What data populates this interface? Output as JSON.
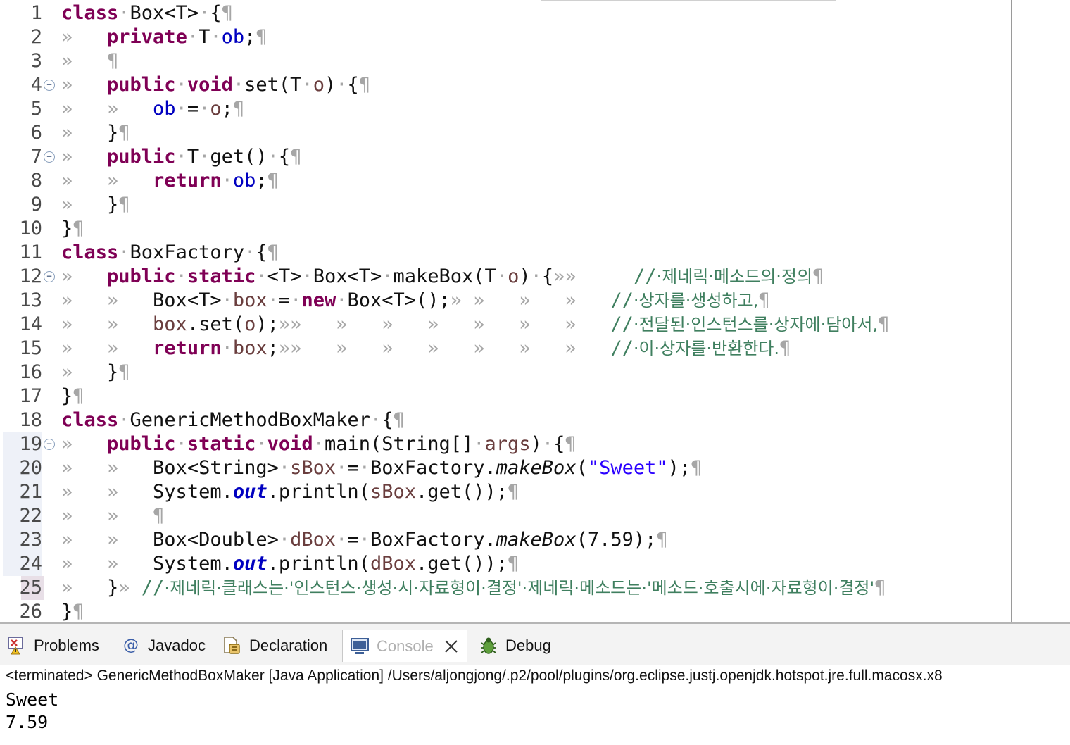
{
  "editor": {
    "line_numbers": [
      "1",
      "2",
      "3",
      "4",
      "5",
      "6",
      "7",
      "8",
      "9",
      "10",
      "11",
      "12",
      "13",
      "14",
      "15",
      "16",
      "17",
      "18",
      "19",
      "20",
      "21",
      "22",
      "23",
      "24",
      "25",
      "26"
    ],
    "lines": [
      [
        [
          "kw",
          "class"
        ],
        [
          "ws",
          "·"
        ],
        [
          "t",
          "Box<T>"
        ],
        [
          "ws",
          "·"
        ],
        [
          "t",
          "{"
        ],
        [
          "ws",
          "¶"
        ]
      ],
      [
        [
          "ws",
          "»   "
        ],
        [
          "kw",
          "private"
        ],
        [
          "ws",
          "·"
        ],
        [
          "t",
          "T"
        ],
        [
          "ws",
          "·"
        ],
        [
          "fld",
          "ob"
        ],
        [
          "t",
          ";"
        ],
        [
          "ws",
          "¶"
        ]
      ],
      [
        [
          "ws",
          "»   "
        ],
        [
          "ws",
          "¶"
        ]
      ],
      [
        [
          "ws",
          "»   "
        ],
        [
          "kw",
          "public"
        ],
        [
          "ws",
          "·"
        ],
        [
          "kw",
          "void"
        ],
        [
          "ws",
          "·"
        ],
        [
          "t",
          "set(T"
        ],
        [
          "ws",
          "·"
        ],
        [
          "var",
          "o"
        ],
        [
          "t",
          ")"
        ],
        [
          "ws",
          "·"
        ],
        [
          "t",
          "{"
        ],
        [
          "ws",
          "¶"
        ]
      ],
      [
        [
          "ws",
          "»   »   "
        ],
        [
          "fld",
          "ob"
        ],
        [
          "ws",
          "·"
        ],
        [
          "t",
          "="
        ],
        [
          "ws",
          "·"
        ],
        [
          "var",
          "o"
        ],
        [
          "t",
          ";"
        ],
        [
          "ws",
          "¶"
        ]
      ],
      [
        [
          "ws",
          "»   "
        ],
        [
          "t",
          "}"
        ],
        [
          "ws",
          "¶"
        ]
      ],
      [
        [
          "ws",
          "»   "
        ],
        [
          "kw",
          "public"
        ],
        [
          "ws",
          "·"
        ],
        [
          "t",
          "T"
        ],
        [
          "ws",
          "·"
        ],
        [
          "t",
          "get()"
        ],
        [
          "ws",
          "·"
        ],
        [
          "t",
          "{"
        ],
        [
          "ws",
          "¶"
        ]
      ],
      [
        [
          "ws",
          "»   »   "
        ],
        [
          "kw",
          "return"
        ],
        [
          "ws",
          "·"
        ],
        [
          "fld",
          "ob"
        ],
        [
          "t",
          ";"
        ],
        [
          "ws",
          "¶"
        ]
      ],
      [
        [
          "ws",
          "»   "
        ],
        [
          "t",
          "}"
        ],
        [
          "ws",
          "¶"
        ]
      ],
      [
        [
          "t",
          "}"
        ],
        [
          "ws",
          "¶"
        ]
      ],
      [
        [
          "kw",
          "class"
        ],
        [
          "ws",
          "·"
        ],
        [
          "t",
          "BoxFactory"
        ],
        [
          "ws",
          "·"
        ],
        [
          "t",
          "{"
        ],
        [
          "ws",
          "¶"
        ]
      ],
      [
        [
          "ws",
          "»   "
        ],
        [
          "kw",
          "public"
        ],
        [
          "ws",
          "·"
        ],
        [
          "kw",
          "static"
        ],
        [
          "ws",
          "·"
        ],
        [
          "t",
          "<T>"
        ],
        [
          "ws",
          "·"
        ],
        [
          "t",
          "Box<T>"
        ],
        [
          "ws",
          "·"
        ],
        [
          "t",
          "makeBox(T"
        ],
        [
          "ws",
          "·"
        ],
        [
          "var",
          "o"
        ],
        [
          "t",
          ")"
        ],
        [
          "ws",
          "·"
        ],
        [
          "t",
          "{"
        ],
        [
          "ws",
          "»»     "
        ],
        [
          "cm",
          "//"
        ],
        [
          "cmt",
          "·제네릭·메소드의·정의"
        ],
        [
          "ws",
          "¶"
        ]
      ],
      [
        [
          "ws",
          "»   »   "
        ],
        [
          "t",
          "Box<T>"
        ],
        [
          "ws",
          "·"
        ],
        [
          "var",
          "box"
        ],
        [
          "ws",
          "·"
        ],
        [
          "t",
          "="
        ],
        [
          "ws",
          "·"
        ],
        [
          "kw",
          "new"
        ],
        [
          "ws",
          "·"
        ],
        [
          "t",
          "Box<T>();"
        ],
        [
          "ws",
          "» »   »   »   "
        ],
        [
          "cm",
          "//"
        ],
        [
          "cmt",
          "·상자를·생성하고,"
        ],
        [
          "ws",
          "¶"
        ]
      ],
      [
        [
          "ws",
          "»   »   "
        ],
        [
          "var",
          "box"
        ],
        [
          "t",
          ".set("
        ],
        [
          "var",
          "o"
        ],
        [
          "t",
          ");"
        ],
        [
          "ws",
          "»»   »   »   »   »   »   »   "
        ],
        [
          "cm",
          "//"
        ],
        [
          "cmt",
          "·전달된·인스턴스를·상자에·담아서,"
        ],
        [
          "ws",
          "¶"
        ]
      ],
      [
        [
          "ws",
          "»   »   "
        ],
        [
          "kw",
          "return"
        ],
        [
          "ws",
          "·"
        ],
        [
          "var",
          "box"
        ],
        [
          "t",
          ";"
        ],
        [
          "ws",
          "»»   »   »   »   »   »   »   "
        ],
        [
          "cm",
          "//"
        ],
        [
          "cmt",
          "·이·상자를·반환한다."
        ],
        [
          "ws",
          "¶"
        ]
      ],
      [
        [
          "ws",
          "»   "
        ],
        [
          "t",
          "}"
        ],
        [
          "ws",
          "¶"
        ]
      ],
      [
        [
          "t",
          "}"
        ],
        [
          "ws",
          "¶"
        ]
      ],
      [
        [
          "kw",
          "class"
        ],
        [
          "ws",
          "·"
        ],
        [
          "t",
          "GenericMethodBoxMaker"
        ],
        [
          "ws",
          "·"
        ],
        [
          "t",
          "{"
        ],
        [
          "ws",
          "¶"
        ]
      ],
      [
        [
          "ws",
          "»   "
        ],
        [
          "kw",
          "public"
        ],
        [
          "ws",
          "·"
        ],
        [
          "kw",
          "static"
        ],
        [
          "ws",
          "·"
        ],
        [
          "kw",
          "void"
        ],
        [
          "ws",
          "·"
        ],
        [
          "t",
          "main(String[]"
        ],
        [
          "ws",
          "·"
        ],
        [
          "var",
          "args"
        ],
        [
          "t",
          ")"
        ],
        [
          "ws",
          "·"
        ],
        [
          "t",
          "{"
        ],
        [
          "ws",
          "¶"
        ]
      ],
      [
        [
          "ws",
          "»   »   "
        ],
        [
          "t",
          "Box<String>"
        ],
        [
          "ws",
          "·"
        ],
        [
          "var",
          "sBox"
        ],
        [
          "ws",
          "·"
        ],
        [
          "t",
          "="
        ],
        [
          "ws",
          "·"
        ],
        [
          "t",
          "BoxFactory."
        ],
        [
          "itm",
          "makeBox"
        ],
        [
          "t",
          "("
        ],
        [
          "str",
          "\"Sweet\""
        ],
        [
          "t",
          ");"
        ],
        [
          "ws",
          "¶"
        ]
      ],
      [
        [
          "ws",
          "»   »   "
        ],
        [
          "t",
          "System."
        ],
        [
          "itf",
          "out"
        ],
        [
          "t",
          ".println("
        ],
        [
          "var",
          "sBox"
        ],
        [
          "t",
          ".get());"
        ],
        [
          "ws",
          "¶"
        ]
      ],
      [
        [
          "ws",
          "»   »   "
        ],
        [
          "ws",
          "¶"
        ]
      ],
      [
        [
          "ws",
          "»   »   "
        ],
        [
          "t",
          "Box<Double>"
        ],
        [
          "ws",
          "·"
        ],
        [
          "var",
          "dBox"
        ],
        [
          "ws",
          "·"
        ],
        [
          "t",
          "="
        ],
        [
          "ws",
          "·"
        ],
        [
          "t",
          "BoxFactory."
        ],
        [
          "itm",
          "makeBox"
        ],
        [
          "t",
          "(7.59);"
        ],
        [
          "ws",
          "¶"
        ]
      ],
      [
        [
          "ws",
          "»   »   "
        ],
        [
          "t",
          "System."
        ],
        [
          "itf",
          "out"
        ],
        [
          "t",
          ".println("
        ],
        [
          "var",
          "dBox"
        ],
        [
          "t",
          ".get());"
        ],
        [
          "ws",
          "¶"
        ]
      ],
      [
        [
          "ws",
          "»   "
        ],
        [
          "t",
          "}"
        ],
        [
          "ws",
          "» "
        ],
        [
          "cm",
          "//"
        ],
        [
          "cmt",
          "·제네릭·클래스는·'인스턴스·생성·시·자료형이·결정'·제네릭·메소드는·'메소드·호출시에·자료형이·결정'"
        ],
        [
          "ws",
          "¶"
        ]
      ],
      [
        [
          "t",
          "}"
        ],
        [
          "ws",
          "¶"
        ]
      ]
    ],
    "fold_lines": [
      4,
      7,
      12,
      19
    ],
    "selected_lines": [
      19,
      20,
      21,
      22,
      23,
      24,
      25
    ],
    "current_line": 25
  },
  "panel": {
    "tabs": [
      {
        "label": "Problems",
        "icon": "problems-icon"
      },
      {
        "label": "Javadoc",
        "icon": "javadoc-icon"
      },
      {
        "label": "Declaration",
        "icon": "declaration-icon"
      },
      {
        "label": "Console",
        "icon": "console-icon",
        "active": true
      },
      {
        "label": "Debug",
        "icon": "debug-icon"
      }
    ],
    "console_header": "<terminated> GenericMethodBoxMaker [Java Application] /Users/aljongjong/.p2/pool/plugins/org.eclipse.justj.openjdk.hotspot.jre.full.macosx.x8",
    "output_lines": [
      "Sweet",
      "7.59"
    ]
  }
}
